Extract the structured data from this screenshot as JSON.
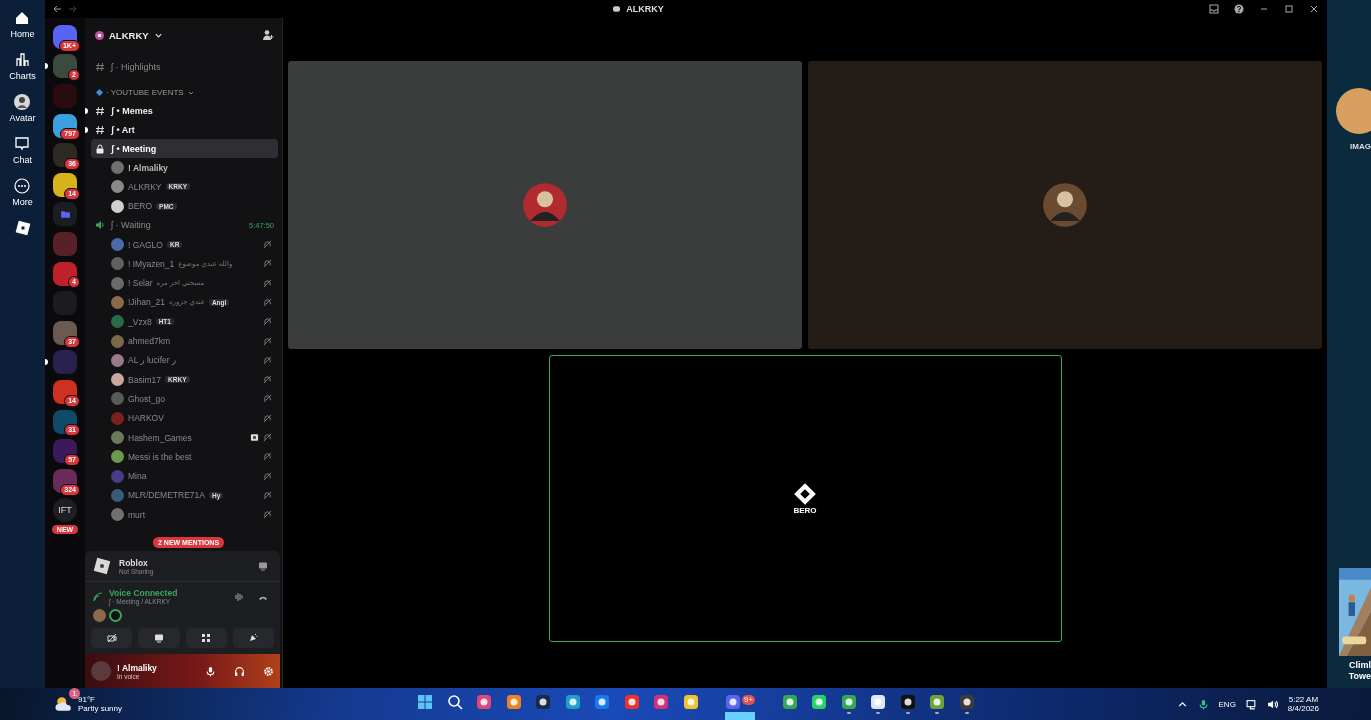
{
  "roblox_nav": {
    "items": [
      {
        "kind": "home",
        "label": "Home"
      },
      {
        "kind": "charts",
        "label": "Charts"
      },
      {
        "kind": "avatar",
        "label": "Avatar"
      },
      {
        "kind": "chat",
        "label": "Chat"
      },
      {
        "kind": "more",
        "label": "More"
      }
    ]
  },
  "window": {
    "title": "ALKRKY"
  },
  "servers": [
    {
      "kind": "icon",
      "badge": "1K+",
      "color": "#5865f2",
      "unread": false
    },
    {
      "kind": "icon",
      "badge": "2",
      "color": "#3a4a3e",
      "unread": true
    },
    {
      "kind": "icon",
      "color": "#2a0c10",
      "unread": false
    },
    {
      "kind": "icon",
      "badge": "797",
      "color": "#3aa0e0",
      "unread": false
    },
    {
      "kind": "icon",
      "badge": "36",
      "color": "#2c2a22",
      "unread": false
    },
    {
      "kind": "icon",
      "badge": "14",
      "color": "#d8b21c",
      "unread": false
    },
    {
      "kind": "folder",
      "color": "#5865f2",
      "unread": false
    },
    {
      "kind": "icon",
      "color": "#5a2028",
      "unread": false
    },
    {
      "kind": "icon",
      "badge": "4",
      "color": "#c0202a",
      "unread": false
    },
    {
      "kind": "icon",
      "color": "#1c1c1e",
      "unread": false
    },
    {
      "kind": "icon",
      "badge": "37",
      "color": "#6a5a52",
      "unread": false
    },
    {
      "kind": "icon",
      "color": "#2a2050",
      "unread": true
    },
    {
      "kind": "icon",
      "badge": "14",
      "color": "#d03020",
      "unread": false
    },
    {
      "kind": "icon",
      "badge": "31",
      "color": "#0f4a6a",
      "unread": false
    },
    {
      "kind": "icon",
      "badge": "57",
      "color": "#3a1a5a",
      "unread": false
    },
    {
      "kind": "icon",
      "badge": "324",
      "color": "#6a2a5a",
      "unread": false
    },
    {
      "kind": "text",
      "label": "IFT",
      "color": "#1e1f22",
      "unread": false
    }
  ],
  "new_pill": "NEW",
  "server_header": {
    "name": "ALKRKY"
  },
  "channels": [
    {
      "kind": "text",
      "name": "ʃ · Highlights",
      "unread": false,
      "selected": false
    },
    {
      "kind": "category",
      "name": "· YOUTUBE EVENTS"
    },
    {
      "kind": "text",
      "name": "ʃ • Memes",
      "unread": true,
      "selected": false
    },
    {
      "kind": "text",
      "name": "ʃ • Art",
      "unread": true,
      "selected": false
    },
    {
      "kind": "voice",
      "locked": true,
      "name": "ʃ • Meeting",
      "selected": true,
      "members": [
        {
          "name": "! Almaliky",
          "deafened": false,
          "streaming": false
        },
        {
          "name": "ALKRKY",
          "tag": "KRKY",
          "deafened": false,
          "streaming": false
        },
        {
          "name": "BERO",
          "tag": "PMC",
          "deafened": false,
          "streaming": false
        }
      ]
    },
    {
      "kind": "voice",
      "locked": false,
      "name": "ʃ · Waiting",
      "selected": false,
      "timer": "5:47:50",
      "members": [
        {
          "name": "! GAGLO",
          "tag": "KR",
          "deafened": true,
          "streaming": false
        },
        {
          "name": "! IMyazen_1",
          "status": "والله عندي موضوع",
          "deafened": true,
          "streaming": false
        },
        {
          "name": "! Selar",
          "status": "مسحتي اخر مره",
          "deafened": true,
          "streaming": false
        },
        {
          "name": "!Jihan_21",
          "status": "عندي جزوره",
          "tag": "Angl",
          "deafened": true,
          "streaming": false
        },
        {
          "name": "_Vzx8",
          "tag": "HT1",
          "deafened": true,
          "streaming": false
        },
        {
          "name": "ahmed7km",
          "deafened": true,
          "streaming": false
        },
        {
          "name": "AL ر lucifer ر",
          "deafened": true,
          "streaming": false
        },
        {
          "name": "Basim17",
          "tag": "KRKY",
          "deafened": true,
          "streaming": false
        },
        {
          "name": "Ghost_go",
          "deafened": true,
          "streaming": false
        },
        {
          "name": "HARKOV",
          "deafened": true,
          "streaming": false
        },
        {
          "name": "Hashem_Games",
          "deafened": true,
          "streaming": true
        },
        {
          "name": "Messi is the best",
          "deafened": true,
          "streaming": false
        },
        {
          "name": "Mina",
          "deafened": true,
          "streaming": false
        },
        {
          "name": "MLR/DEMETRE71A",
          "tag": "Hy",
          "deafened": true,
          "streaming": false
        },
        {
          "name": "murt",
          "deafened": true,
          "streaming": false
        }
      ]
    }
  ],
  "mentions_banner": "2 NEW MENTIONS",
  "activity": {
    "game": "Roblox",
    "status": "Not Sharing"
  },
  "voice": {
    "status": "Voice Connected",
    "channel": "ʃ · Meeting / ALKRKY"
  },
  "user": {
    "name": "! Almaliky",
    "status": "In voice"
  },
  "tiles": [
    {
      "kind": "avatar",
      "speaking": false
    },
    {
      "kind": "avatar",
      "speaking": false
    },
    {
      "kind": "logo",
      "label": "BERO",
      "speaking": true
    }
  ],
  "right_strip": {
    "avatar_label": "IMAG",
    "game_title_lines": [
      "Climl",
      "Towe"
    ]
  },
  "taskbar": {
    "weather": {
      "temp": "91°F",
      "condition": "Partly sunny",
      "badge": "1"
    },
    "apps": [
      {
        "kind": "start",
        "running": false
      },
      {
        "kind": "search",
        "running": false
      },
      {
        "kind": "pink",
        "running": false
      },
      {
        "kind": "cloud",
        "running": false
      },
      {
        "kind": "people",
        "running": false
      },
      {
        "kind": "edge",
        "running": false
      },
      {
        "kind": "facebook",
        "running": false
      },
      {
        "kind": "red",
        "running": false
      },
      {
        "kind": "instagram",
        "running": false
      },
      {
        "kind": "folder",
        "running": false
      },
      {
        "kind": "discord",
        "badge": "9+",
        "running": true
      },
      {
        "kind": "chrome",
        "running": false
      },
      {
        "kind": "whatsapp",
        "running": false
      },
      {
        "kind": "chrome",
        "running": true
      },
      {
        "kind": "roblox",
        "running": true
      },
      {
        "kind": "capcut",
        "running": true
      },
      {
        "kind": "minecraft",
        "running": true
      },
      {
        "kind": "obs",
        "running": true
      }
    ],
    "tray": {
      "language": "ENG",
      "time": "5:22 AM",
      "date": "8/4/2026"
    }
  }
}
